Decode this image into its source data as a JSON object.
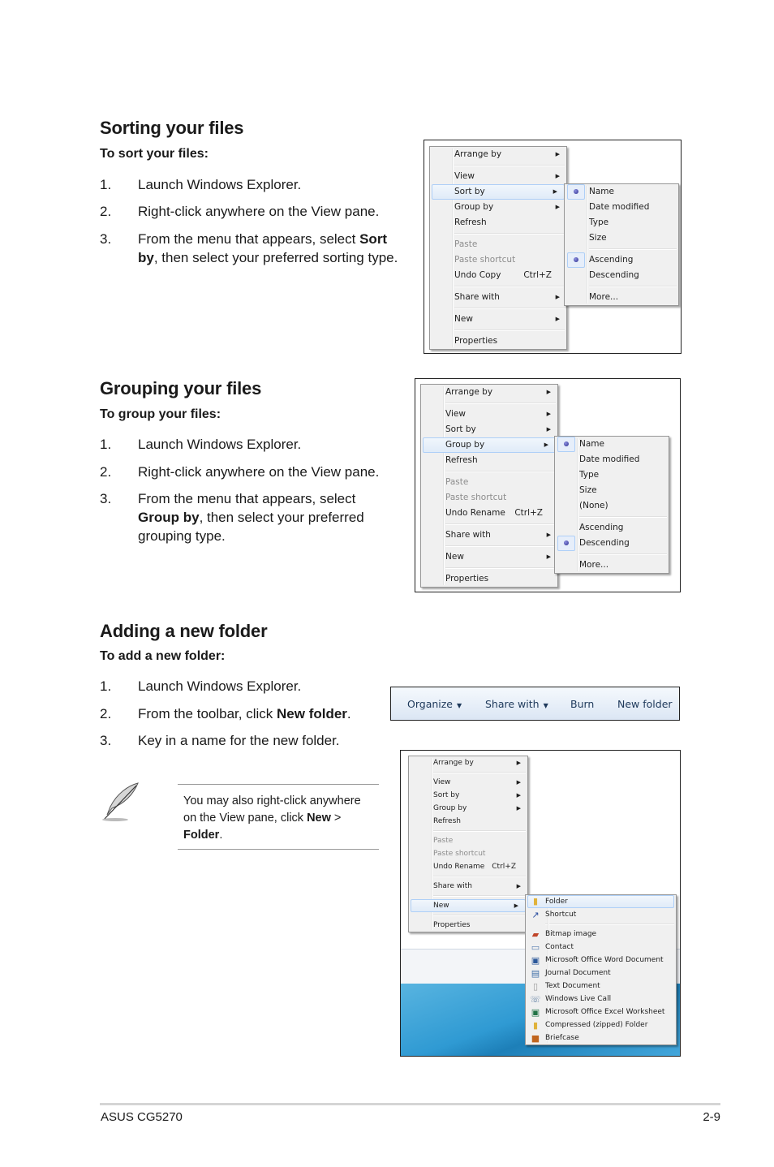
{
  "sections": {
    "sorting": {
      "title": "Sorting your files",
      "subtitle": "To sort your files:",
      "steps": [
        {
          "num": "1.",
          "text": "Launch Windows Explorer."
        },
        {
          "num": "2.",
          "text": "Right-click anywhere on the View pane."
        },
        {
          "num": "3.",
          "pre": "From the menu that appears, select ",
          "bold1": "Sort",
          "bold2": "by",
          "post": ", then select your preferred sorting type."
        }
      ],
      "menu": {
        "items": [
          "Arrange by",
          "View",
          "Sort by",
          "Group by",
          "Refresh",
          "Paste",
          "Paste shortcut",
          "Undo Copy",
          "Share with",
          "New",
          "Properties"
        ],
        "shortcut": "Ctrl+Z",
        "submenu": [
          "Name",
          "Date modified",
          "Type",
          "Size",
          "Ascending",
          "Descending",
          "More..."
        ]
      }
    },
    "grouping": {
      "title": "Grouping your files",
      "subtitle": "To group your files:",
      "steps": [
        {
          "num": "1.",
          "text": "Launch Windows Explorer."
        },
        {
          "num": "2.",
          "text": "Right-click anywhere on the View pane."
        },
        {
          "num": "3.",
          "pre": "From the menu that appears, select",
          "bold1": "Group by",
          "post1": ", then select your preferred",
          "post2": "grouping type."
        }
      ],
      "menu": {
        "items": [
          "Arrange by",
          "View",
          "Sort by",
          "Group by",
          "Refresh",
          "Paste",
          "Paste shortcut",
          "Undo Rename",
          "Share with",
          "New",
          "Properties"
        ],
        "shortcut": "Ctrl+Z",
        "submenu": [
          "Name",
          "Date modified",
          "Type",
          "Size",
          "(None)",
          "Ascending",
          "Descending",
          "More..."
        ]
      }
    },
    "new_folder": {
      "title": "Adding a new folder",
      "subtitle": "To add a new folder:",
      "steps": [
        {
          "num": "1.",
          "text": "Launch Windows Explorer."
        },
        {
          "num": "2.",
          "pre": "From the toolbar, click ",
          "bold1": "New folder",
          "post": "."
        },
        {
          "num": "3.",
          "text": "Key in a name for the new folder."
        }
      ],
      "toolbar": {
        "organize": "Organize",
        "share_with": "Share with",
        "burn": "Burn",
        "new_folder": "New folder",
        "caret": "▼"
      },
      "menu": {
        "items": [
          "Arrange by",
          "View",
          "Sort by",
          "Group by",
          "Refresh",
          "Paste",
          "Paste shortcut",
          "Undo Rename",
          "Share with",
          "New",
          "Properties"
        ],
        "shortcut": "Ctrl+Z",
        "submenu": [
          "Folder",
          "Shortcut",
          "Bitmap image",
          "Contact",
          "Microsoft Office Word Document",
          "Journal Document",
          "Text Document",
          "Windows Live Call",
          "Microsoft Office Excel Worksheet",
          "Compressed (zipped) Folder",
          "Briefcase"
        ]
      },
      "note": {
        "line1": "You may also right-click anywhere",
        "line2_pre": "on the View pane, click ",
        "line2_bold": "New",
        "line2_post": " >",
        "line3_bold": "Folder",
        "line3_post": "."
      }
    }
  },
  "arrow": "▶",
  "footer": {
    "left": "ASUS CG5270",
    "right": "2-9"
  }
}
